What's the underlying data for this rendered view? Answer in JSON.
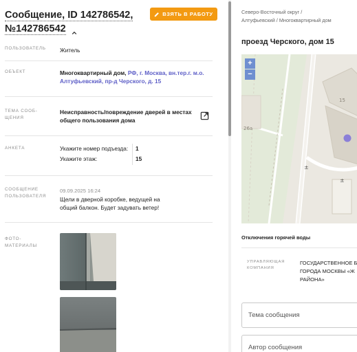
{
  "message": {
    "title_line1": "Сообщение, ID 142786542,",
    "title_line2": "№142786542",
    "take_button": "ВЗЯТЬ В РАБОТУ"
  },
  "fields": {
    "user_label": "ПОЛЬЗОВАТЕЛЬ",
    "user_value": "Житель",
    "object_label": "ОБЪЕКТ",
    "object_type": "Многоквартирный дом,",
    "object_addr_1": "РФ, г. Москва, вн.тер.г. м.о.",
    "object_addr_2": "Алтуфьевский, пр-д Черского, д. 15",
    "topic_label_1": "ТЕМА СООБ-",
    "topic_label_2": "ЩЕНИЯ",
    "topic_value_1": "Неисправность/повреждение дверей в местах",
    "topic_value_2": "общего пользования дома",
    "form_label": "АНКЕТА",
    "q1": "Укажите номер подъезда:",
    "a1": "1",
    "q2": "Укажите этаж:",
    "a2": "15",
    "msg_label_1": "СООБЩЕНИЕ",
    "msg_label_2": "ПОЛЬЗОВАТЕЛЯ",
    "msg_date": "09.09.2025 16:24",
    "msg_text_1": "Щели в дверной коробке, ведущей на",
    "msg_text_2": "общий балкон. Будет задувать ветер!",
    "photo_label_1": "ФОТО-",
    "photo_label_2": "МАТЕРИАЛЫ"
  },
  "side": {
    "crumb_1": "Северо-Восточный округ /",
    "crumb_2": "Алтуфьевский / Многоквартирный дом",
    "address": "проезд Черского, дом 15",
    "zoom_in": "+",
    "zoom_out": "−",
    "map_labels": {
      "building": "15",
      "lot": "26а"
    },
    "hot_water": "Отключения горячей воды",
    "uk_label_1": "УПРАВЛЯЮЩАЯ",
    "uk_label_2": "КОМПАНИЯ",
    "uk_value_1": "ГОСУДАРСТВЕННОЕ Б",
    "uk_value_2": "ГОРОДА МОСКВЫ «Ж",
    "uk_value_3": "РАЙОНА»",
    "topic_placeholder": "Тема сообщения",
    "author_placeholder": "Автор сообщения"
  },
  "colors": {
    "accent_orange": "#f39a12",
    "link": "#5e5fc7",
    "zoom": "#6f8fd0",
    "marker": "#8b7fd8"
  }
}
